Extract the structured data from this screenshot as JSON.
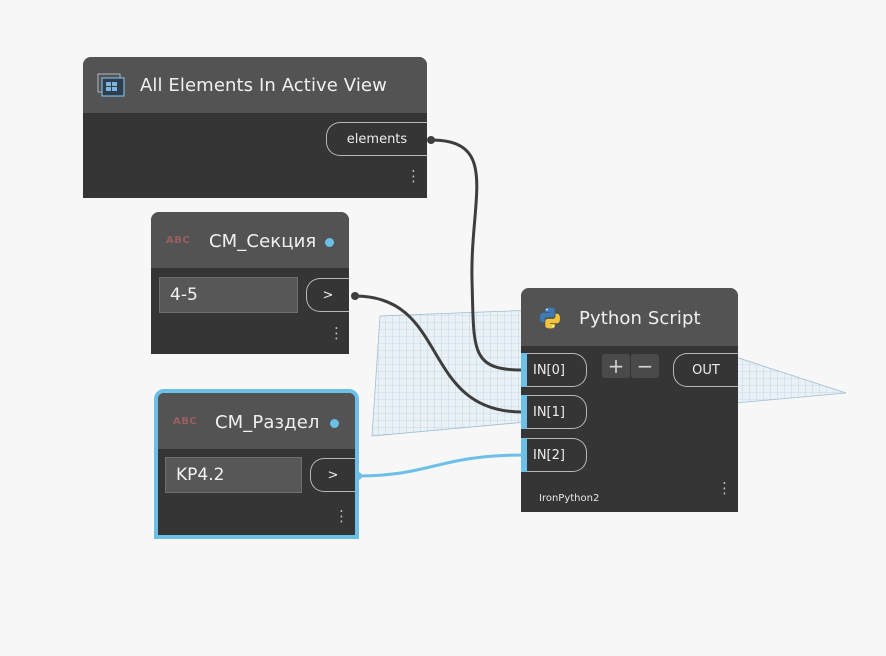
{
  "nodes": {
    "all_elements": {
      "title": "All Elements In Active View",
      "output_port": "elements",
      "icon": "view-elements-icon"
    },
    "section_input": {
      "type_icon": "ABC",
      "title": "CM_Секция",
      "value": "4-5",
      "output_port": ">"
    },
    "part_input": {
      "type_icon": "ABC",
      "title": "CM_Раздел",
      "value": "KP4.2",
      "output_port": ">",
      "selected": true
    },
    "python_script": {
      "title": "Python Script",
      "inputs": [
        "IN[0]",
        "IN[1]",
        "IN[2]"
      ],
      "output_port": "OUT",
      "add_label": "+",
      "remove_label": "−",
      "engine": "IronPython2",
      "icon": "python-icon"
    }
  },
  "colors": {
    "selection": "#6cc0e8",
    "wire": "#3e3e3e",
    "node_body": "#353535",
    "node_header": "#535353"
  }
}
